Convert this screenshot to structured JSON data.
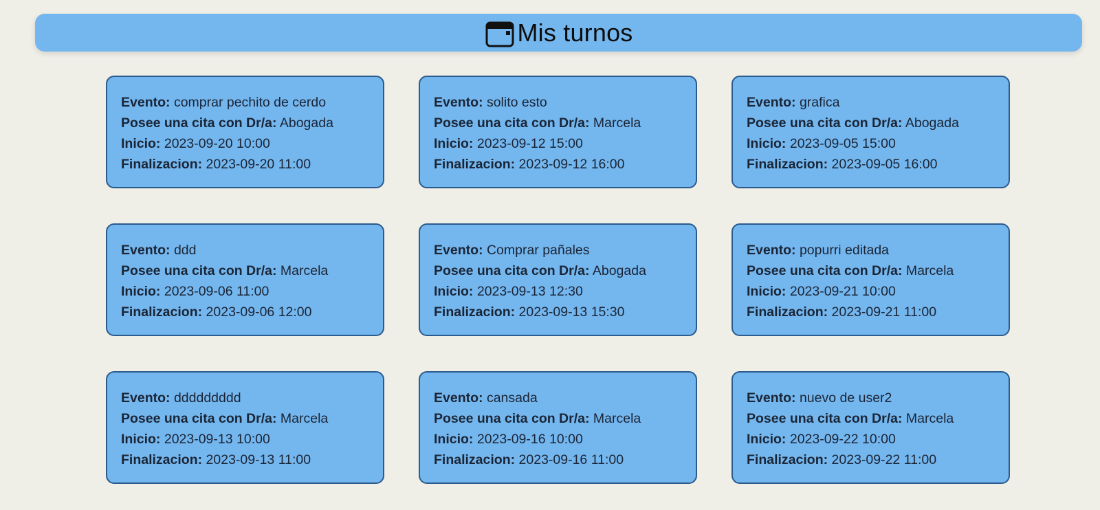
{
  "header": {
    "title": "Mis turnos",
    "icon": "calendar-icon"
  },
  "labels": {
    "evento": "Evento:",
    "cita": "Posee una cita con Dr/a:",
    "inicio": "Inicio:",
    "fin": "Finalizacion:"
  },
  "appointments": [
    {
      "evento": "comprar pechito de cerdo",
      "doctor": "Abogada",
      "inicio": "2023-09-20 10:00",
      "fin": "2023-09-20 11:00"
    },
    {
      "evento": "solito esto",
      "doctor": "Marcela",
      "inicio": "2023-09-12 15:00",
      "fin": "2023-09-12 16:00"
    },
    {
      "evento": "grafica",
      "doctor": "Abogada",
      "inicio": "2023-09-05 15:00",
      "fin": "2023-09-05 16:00"
    },
    {
      "evento": "ddd",
      "doctor": "Marcela",
      "inicio": "2023-09-06 11:00",
      "fin": "2023-09-06 12:00"
    },
    {
      "evento": "Comprar pañales",
      "doctor": "Abogada",
      "inicio": "2023-09-13 12:30",
      "fin": "2023-09-13 15:30"
    },
    {
      "evento": "popurri editada",
      "doctor": "Marcela",
      "inicio": "2023-09-21 10:00",
      "fin": "2023-09-21 11:00"
    },
    {
      "evento": "ddddddddd",
      "doctor": "Marcela",
      "inicio": "2023-09-13 10:00",
      "fin": "2023-09-13 11:00"
    },
    {
      "evento": "cansada",
      "doctor": "Marcela",
      "inicio": "2023-09-16 10:00",
      "fin": "2023-09-16 11:00"
    },
    {
      "evento": "nuevo de user2",
      "doctor": "Marcela",
      "inicio": "2023-09-22 10:00",
      "fin": "2023-09-22 11:00"
    }
  ],
  "colors": {
    "background": "#efeee7",
    "card": "#74b6ee",
    "card_border": "#2b5a8c",
    "text": "#1a2536"
  }
}
